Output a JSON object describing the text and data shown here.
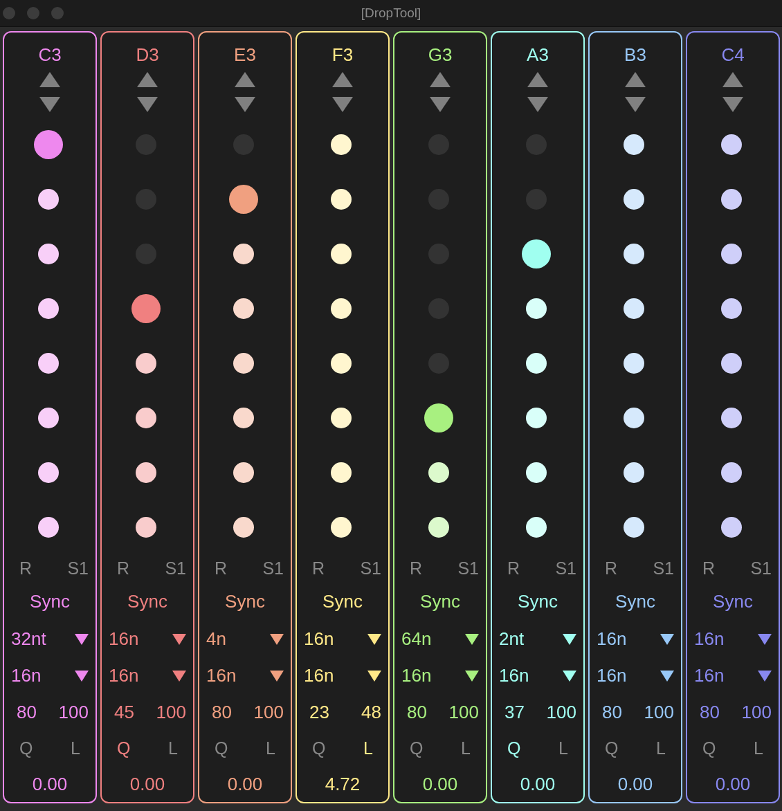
{
  "window": {
    "title": "[DropTool]"
  },
  "columns": [
    {
      "note": "C3",
      "color": "#ee88ee",
      "dots": [
        {
          "lit": true,
          "selected": true
        },
        {
          "lit": true,
          "selected": false
        },
        {
          "lit": true,
          "selected": false
        },
        {
          "lit": true,
          "selected": false
        },
        {
          "lit": true,
          "selected": false
        },
        {
          "lit": true,
          "selected": false
        },
        {
          "lit": true,
          "selected": false
        },
        {
          "lit": true,
          "selected": false
        }
      ],
      "r": "R",
      "s": "S1",
      "sync": "Sync",
      "rate": "32nt",
      "length": "16n",
      "num_1": "80",
      "num_2": "100",
      "q": {
        "label": "Q",
        "on": false
      },
      "l": {
        "label": "L",
        "on": false
      },
      "value": "0.00"
    },
    {
      "note": "D3",
      "color": "#f08080",
      "dots": [
        {
          "lit": false,
          "selected": false
        },
        {
          "lit": false,
          "selected": false
        },
        {
          "lit": false,
          "selected": false
        },
        {
          "lit": true,
          "selected": true
        },
        {
          "lit": true,
          "selected": false
        },
        {
          "lit": true,
          "selected": false
        },
        {
          "lit": true,
          "selected": false
        },
        {
          "lit": true,
          "selected": false
        }
      ],
      "r": "R",
      "s": "S1",
      "sync": "Sync",
      "rate": "16n",
      "length": "16n",
      "num_1": "45",
      "num_2": "100",
      "q": {
        "label": "Q",
        "on": true
      },
      "l": {
        "label": "L",
        "on": false
      },
      "value": "0.00"
    },
    {
      "note": "E3",
      "color": "#f0a080",
      "dots": [
        {
          "lit": false,
          "selected": false
        },
        {
          "lit": true,
          "selected": true
        },
        {
          "lit": true,
          "selected": false
        },
        {
          "lit": true,
          "selected": false
        },
        {
          "lit": true,
          "selected": false
        },
        {
          "lit": true,
          "selected": false
        },
        {
          "lit": true,
          "selected": false
        },
        {
          "lit": true,
          "selected": false
        }
      ],
      "r": "R",
      "s": "S1",
      "sync": "Sync",
      "rate": "4n",
      "length": "16n",
      "num_1": "80",
      "num_2": "100",
      "q": {
        "label": "Q",
        "on": false
      },
      "l": {
        "label": "L",
        "on": false
      },
      "value": "0.00"
    },
    {
      "note": "F3",
      "color": "#ffe888",
      "dots": [
        {
          "lit": true,
          "selected": false
        },
        {
          "lit": true,
          "selected": false
        },
        {
          "lit": true,
          "selected": false
        },
        {
          "lit": true,
          "selected": false
        },
        {
          "lit": true,
          "selected": false
        },
        {
          "lit": true,
          "selected": false
        },
        {
          "lit": true,
          "selected": false
        },
        {
          "lit": true,
          "selected": false
        }
      ],
      "r": "R",
      "s": "S1",
      "sync": "Sync",
      "rate": "16n",
      "length": "16n",
      "num_1": "23",
      "num_2": "48",
      "q": {
        "label": "Q",
        "on": false
      },
      "l": {
        "label": "L",
        "on": true
      },
      "value": "4.72"
    },
    {
      "note": "G3",
      "color": "#a8f080",
      "dots": [
        {
          "lit": false,
          "selected": false
        },
        {
          "lit": false,
          "selected": false
        },
        {
          "lit": false,
          "selected": false
        },
        {
          "lit": false,
          "selected": false
        },
        {
          "lit": false,
          "selected": false
        },
        {
          "lit": true,
          "selected": true
        },
        {
          "lit": true,
          "selected": false
        },
        {
          "lit": true,
          "selected": false
        }
      ],
      "r": "R",
      "s": "S1",
      "sync": "Sync",
      "rate": "64n",
      "length": "16n",
      "num_1": "80",
      "num_2": "100",
      "q": {
        "label": "Q",
        "on": false
      },
      "l": {
        "label": "L",
        "on": false
      },
      "value": "0.00"
    },
    {
      "note": "A3",
      "color": "#a0fff0",
      "dots": [
        {
          "lit": false,
          "selected": false
        },
        {
          "lit": false,
          "selected": false
        },
        {
          "lit": true,
          "selected": true
        },
        {
          "lit": true,
          "selected": false
        },
        {
          "lit": true,
          "selected": false
        },
        {
          "lit": true,
          "selected": false
        },
        {
          "lit": true,
          "selected": false
        },
        {
          "lit": true,
          "selected": false
        }
      ],
      "r": "R",
      "s": "S1",
      "sync": "Sync",
      "rate": "2nt",
      "length": "16n",
      "num_1": "37",
      "num_2": "100",
      "q": {
        "label": "Q",
        "on": true
      },
      "l": {
        "label": "L",
        "on": false
      },
      "value": "0.00"
    },
    {
      "note": "B3",
      "color": "#98c8f8",
      "dots": [
        {
          "lit": true,
          "selected": false
        },
        {
          "lit": true,
          "selected": false
        },
        {
          "lit": true,
          "selected": false
        },
        {
          "lit": true,
          "selected": false
        },
        {
          "lit": true,
          "selected": false
        },
        {
          "lit": true,
          "selected": false
        },
        {
          "lit": true,
          "selected": false
        },
        {
          "lit": true,
          "selected": false
        }
      ],
      "r": "R",
      "s": "S1",
      "sync": "Sync",
      "rate": "16n",
      "length": "16n",
      "num_1": "80",
      "num_2": "100",
      "q": {
        "label": "Q",
        "on": false
      },
      "l": {
        "label": "L",
        "on": false
      },
      "value": "0.00"
    },
    {
      "note": "C4",
      "color": "#8888f0",
      "dots": [
        {
          "lit": true,
          "selected": false
        },
        {
          "lit": true,
          "selected": false
        },
        {
          "lit": true,
          "selected": false
        },
        {
          "lit": true,
          "selected": false
        },
        {
          "lit": true,
          "selected": false
        },
        {
          "lit": true,
          "selected": false
        },
        {
          "lit": true,
          "selected": false
        },
        {
          "lit": true,
          "selected": false
        }
      ],
      "r": "R",
      "s": "S1",
      "sync": "Sync",
      "rate": "16n",
      "length": "16n",
      "num_1": "80",
      "num_2": "100",
      "q": {
        "label": "Q",
        "on": false
      },
      "l": {
        "label": "L",
        "on": false
      },
      "value": "0.00"
    }
  ]
}
